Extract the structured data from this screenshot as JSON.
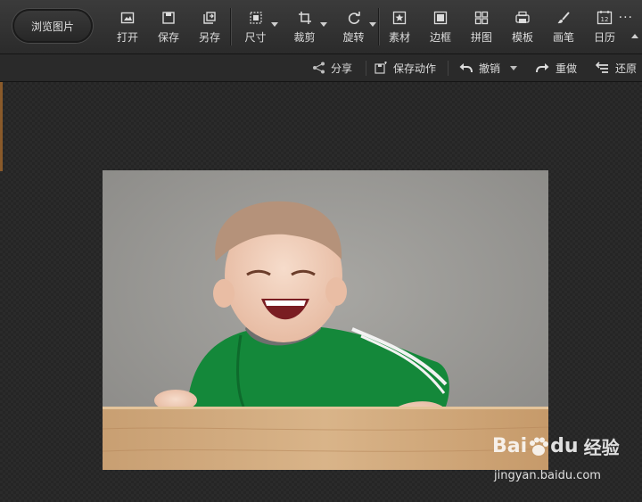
{
  "toolbar": {
    "browse_label": "浏览图片",
    "tools": [
      {
        "label": "打开",
        "icon": "open-icon"
      },
      {
        "label": "保存",
        "icon": "save-icon"
      },
      {
        "label": "另存",
        "icon": "save-as-icon"
      },
      {
        "label": "尺寸",
        "icon": "resize-icon",
        "dropdown": true
      },
      {
        "label": "裁剪",
        "icon": "crop-icon",
        "dropdown": true
      },
      {
        "label": "旋转",
        "icon": "rotate-icon",
        "dropdown": true
      },
      {
        "label": "素材",
        "icon": "material-icon"
      },
      {
        "label": "边框",
        "icon": "border-icon"
      },
      {
        "label": "拼图",
        "icon": "collage-icon"
      },
      {
        "label": "模板",
        "icon": "template-icon"
      },
      {
        "label": "画笔",
        "icon": "brush-icon"
      },
      {
        "label": "日历",
        "icon": "calendar-icon"
      }
    ],
    "more_label": "···"
  },
  "subbar": {
    "share_label": "分享",
    "save_action_label": "保存动作",
    "undo_label": "撤销",
    "redo_label": "重做",
    "restore_label": "还原"
  },
  "watermark": {
    "brand": "Bai",
    "brand2": "du",
    "brand_cn": "经验",
    "url": "jingyan.baidu.com"
  },
  "calendar_day": "12"
}
